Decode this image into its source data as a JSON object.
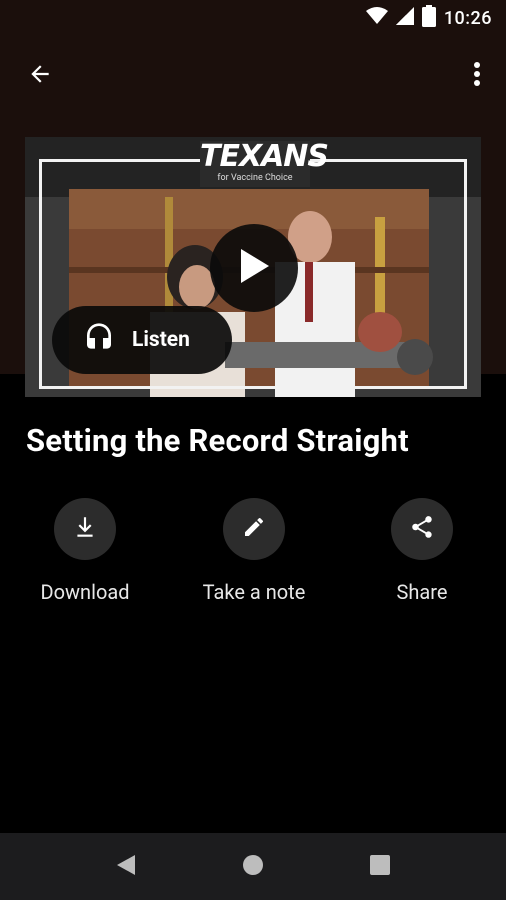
{
  "status_bar": {
    "time": "10:26",
    "icons": [
      "wifi-icon",
      "signal-icon",
      "battery-icon"
    ]
  },
  "app_bar": {
    "back_icon": "arrow-back-icon",
    "more_icon": "more-vert-icon"
  },
  "media": {
    "thumbnail_logo": "TEXANS",
    "thumbnail_logo_sub": "for Vaccine Choice",
    "play_icon": "play-icon",
    "listen_label": "Listen",
    "listen_icon": "headphones-icon"
  },
  "episode": {
    "title": "Setting the Record Straight"
  },
  "actions": [
    {
      "label": "Download",
      "icon": "download-icon"
    },
    {
      "label": "Take a note",
      "icon": "pencil-icon"
    },
    {
      "label": "Share",
      "icon": "share-icon"
    }
  ],
  "nav_bar": {
    "icons": [
      "nav-back-icon",
      "nav-home-icon",
      "nav-recents-icon"
    ]
  },
  "colors": {
    "header_bg": "#1b0f0c",
    "page_bg": "#000000",
    "action_circle_bg": "#2c2c2c",
    "nav_bar_bg": "#1c1c1e"
  }
}
